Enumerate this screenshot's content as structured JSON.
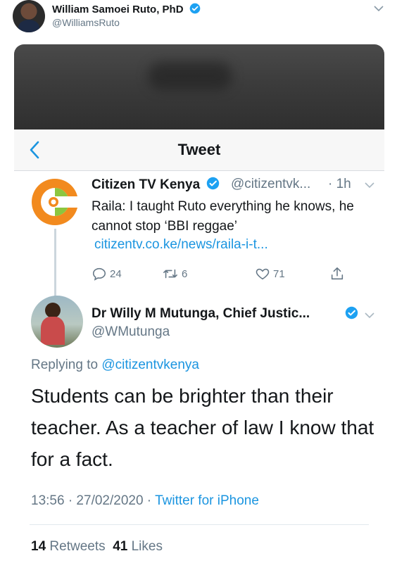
{
  "outer": {
    "name": "William Samoei Ruto, PhD",
    "handle": "@WilliamsRuto"
  },
  "screen": {
    "nav_title": "Tweet"
  },
  "quoted_tweet": {
    "name": "Citizen TV Kenya",
    "handle": "@citizentvk...",
    "time": "· 1h",
    "text": "Raila: I taught Ruto everything he knows, he cannot stop ‘BBI reggae’",
    "link": "citizentv.co.ke/news/raila-i-t...",
    "replies": "24",
    "retweets": "6",
    "likes": "71"
  },
  "reply_tweet": {
    "name": "Dr Willy M Mutunga, Chief Justic...",
    "handle": "@WMutunga",
    "replying_prefix": "Replying to",
    "replying_to": "@citizentvkenya",
    "text": "Students can be brighter than their teacher. As a teacher of law I know that for a fact.",
    "timestamp": "13:56 · 27/02/2020 ·",
    "source": "Twitter for iPhone",
    "retweet_count": "14",
    "retweet_label": "Retweets",
    "like_count": "41",
    "like_label": "Likes"
  },
  "colors": {
    "accent": "#1b95e0",
    "muted": "#657786",
    "logo_orange": "#f28a1e",
    "logo_green": "#8cc63f"
  }
}
